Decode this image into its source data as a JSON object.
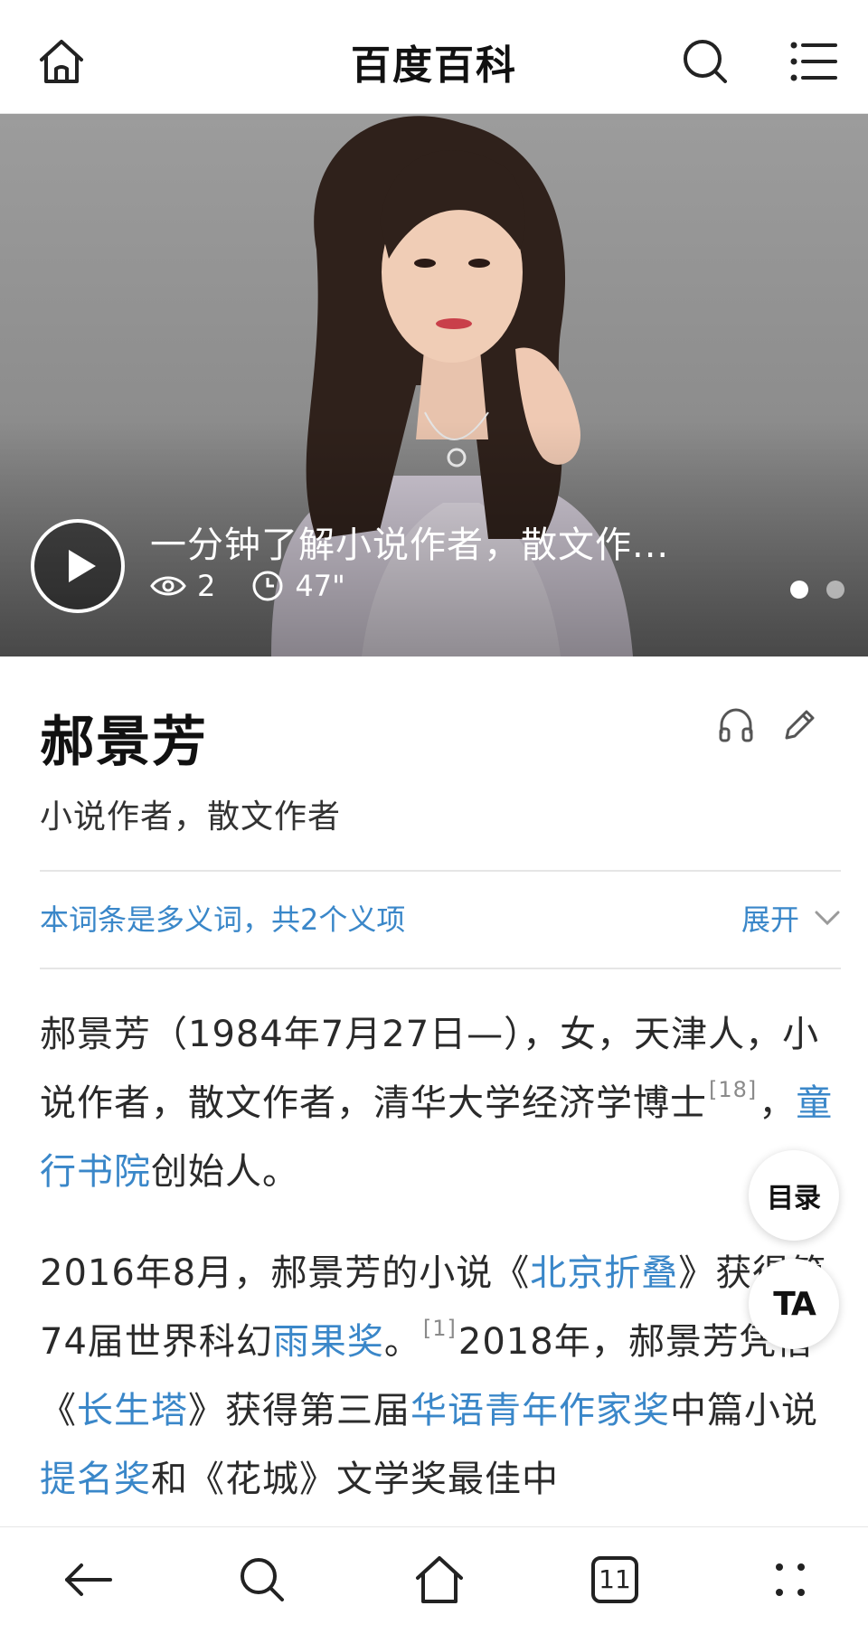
{
  "header": {
    "title": "百度百科",
    "icons": [
      "home-icon",
      "search-icon",
      "menu-icon"
    ]
  },
  "hero": {
    "video_title": "一分钟了解小说作者，散文作...",
    "views": "2",
    "duration": "47\"",
    "slide_count": 2,
    "active_slide": 1
  },
  "entry": {
    "title": "郝景芳",
    "subtitle": "小说作者，散文作者",
    "polysemy_note": "本词条是多义词，共2个义项",
    "expand_label": "展开"
  },
  "paragraph1": {
    "text_a": "郝景芳（1984年7月27日—），女，天津人，小说作者，散文作者，清华大学经济学博士",
    "cite_a": "[18]",
    "text_b": "，",
    "link_a": "童行书院",
    "text_c": "创始人。"
  },
  "paragraph2": {
    "text_a": "2016年8月，郝景芳的小说《",
    "link_a": "北京折叠",
    "text_b": "》获得第74届世界科幻",
    "link_b": "雨果奖",
    "text_c": "。",
    "cite_a": "[1]",
    "text_d": "2018年，郝景芳凭借《",
    "link_c": "长生塔",
    "text_e": "》获得第三届",
    "link_d": "华语青年作家奖",
    "text_f": "中篇小说",
    "link_e": "提名奖",
    "text_g": "和《花城》文学奖最佳中"
  },
  "float_buttons": {
    "toc_label": "目录",
    "ta_label": "TA"
  },
  "bottom_nav": {
    "tab_count": "11",
    "icons": [
      "back-arrow-icon",
      "search-icon",
      "home-icon",
      "tabs-icon",
      "more-icon"
    ]
  },
  "colors": {
    "link": "#3a87c9",
    "text": "#2a2a2a"
  }
}
